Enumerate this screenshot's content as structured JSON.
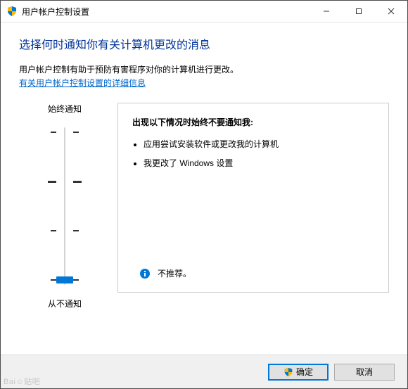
{
  "window": {
    "title": "用户帐户控制设置"
  },
  "content": {
    "heading": "选择何时通知你有关计算机更改的消息",
    "description": "用户帐户控制有助于预防有害程序对你的计算机进行更改。",
    "link_text": "有关用户帐户控制设置的详细信息"
  },
  "slider": {
    "top_label": "始终通知",
    "bottom_label": "从不通知"
  },
  "info_box": {
    "title": "出现以下情况时始终不要通知我:",
    "bullets": [
      "应用尝试安装软件或更改我的计算机",
      "我更改了 Windows 设置"
    ],
    "recommendation": "不推荐。"
  },
  "buttons": {
    "ok": "确定",
    "cancel": "取消"
  },
  "watermark": "Bai☺贴吧"
}
